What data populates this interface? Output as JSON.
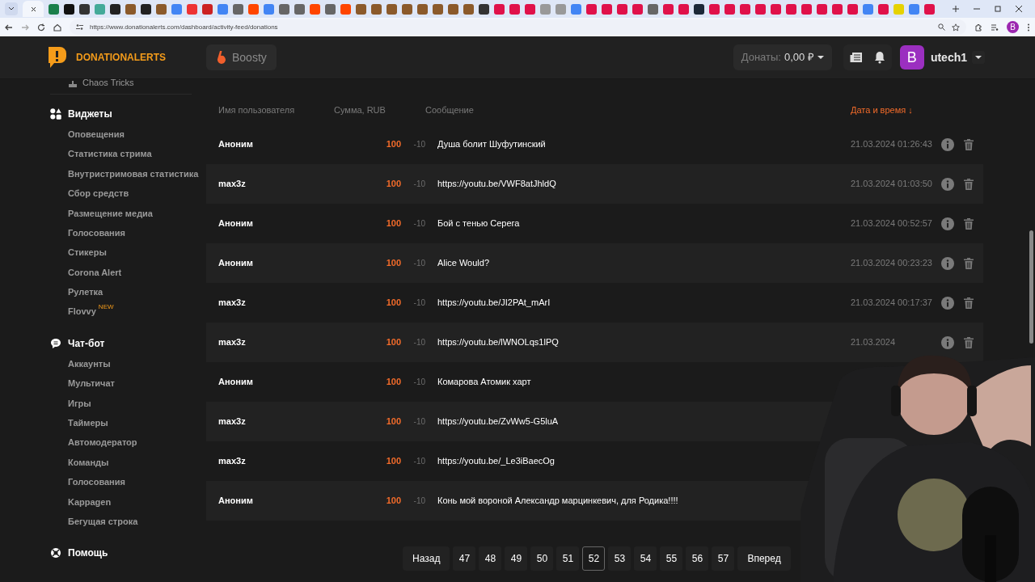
{
  "browser": {
    "url": "https://www.donationalerts.com/dashboard/activity-feed/donations",
    "profile_initial": "B"
  },
  "header": {
    "brand": "DONATIONALERTS",
    "boosty": "Boosty",
    "donations_label": "Донаты:",
    "donations_value": "0,00 ₽",
    "avatar": "B",
    "username": "utech1"
  },
  "sidebar": {
    "cut_item": "Chaos Tricks",
    "groups": [
      {
        "kind": "widgets",
        "title": "Виджеты",
        "items": [
          {
            "label": "Оповещения"
          },
          {
            "label": "Статистика стрима"
          },
          {
            "label": "Внутристримовая статистика"
          },
          {
            "label": "Сбор средств"
          },
          {
            "label": "Размещение медиа"
          },
          {
            "label": "Голосования"
          },
          {
            "label": "Стикеры"
          },
          {
            "label": "Corona Alert"
          },
          {
            "label": "Рулетка"
          },
          {
            "label": "Flovvy",
            "badge": "NEW"
          }
        ]
      },
      {
        "kind": "chat",
        "title": "Чат-бот",
        "items": [
          {
            "label": "Аккаунты"
          },
          {
            "label": "Мультичат"
          },
          {
            "label": "Игры"
          },
          {
            "label": "Таймеры"
          },
          {
            "label": "Автомодератор"
          },
          {
            "label": "Команды"
          },
          {
            "label": "Голосования"
          },
          {
            "label": "Kappagen"
          },
          {
            "label": "Бегущая строка"
          }
        ]
      },
      {
        "kind": "help",
        "title": "Помощь"
      }
    ]
  },
  "table": {
    "columns": [
      {
        "label": "Имя пользователя",
        "sorted": false
      },
      {
        "label": "Сумма, RUB",
        "sorted": false
      },
      {
        "label": "Сообщение",
        "sorted": false
      },
      {
        "label": "Дата и время ↓",
        "sorted": true
      }
    ],
    "rows": [
      {
        "user": "Аноним",
        "amount": "100",
        "fee": "-10",
        "message": "Душа болит Шуфутинский",
        "date": "21.03.2024 01:26:43"
      },
      {
        "user": "max3z",
        "amount": "100",
        "fee": "-10",
        "message": "https://youtu.be/VWF8atJhldQ",
        "date": "21.03.2024 01:03:50"
      },
      {
        "user": "Аноним",
        "amount": "100",
        "fee": "-10",
        "message": "Бой с тенью Серега",
        "date": "21.03.2024 00:52:57"
      },
      {
        "user": "Аноним",
        "amount": "100",
        "fee": "-10",
        "message": "Alice Would?",
        "date": "21.03.2024 00:23:23"
      },
      {
        "user": "max3z",
        "amount": "100",
        "fee": "-10",
        "message": "https://youtu.be/JI2PAt_mArI",
        "date": "21.03.2024 00:17:37"
      },
      {
        "user": "max3z",
        "amount": "100",
        "fee": "-10",
        "message": "https://youtu.be/lWNOLqs1lPQ",
        "date": "21.03.2024"
      },
      {
        "user": "Аноним",
        "amount": "100",
        "fee": "-10",
        "message": "Комарова Атомик харт"
      },
      {
        "user": "max3z",
        "amount": "100",
        "fee": "-10",
        "message": "https://youtu.be/ZvWw5-G5luA"
      },
      {
        "user": "max3z",
        "amount": "100",
        "fee": "-10",
        "message": "https://youtu.be/_Le3iBaecOg"
      },
      {
        "user": "Аноним",
        "amount": "100",
        "fee": "-10",
        "message": "Конь мой вороной Александр марцинкевич, для Родика!!!!"
      }
    ]
  },
  "pagination": {
    "prev": "Назад",
    "next": "Вперед",
    "pages": [
      {
        "label": "47",
        "selected": false
      },
      {
        "label": "48",
        "selected": false
      },
      {
        "label": "49",
        "selected": false
      },
      {
        "label": "50",
        "selected": false
      },
      {
        "label": "51",
        "selected": false
      },
      {
        "label": "52",
        "selected": true
      },
      {
        "label": "53",
        "selected": false
      },
      {
        "label": "54",
        "selected": false
      },
      {
        "label": "55",
        "selected": false
      },
      {
        "label": "56",
        "selected": false
      },
      {
        "label": "57",
        "selected": false
      }
    ]
  }
}
